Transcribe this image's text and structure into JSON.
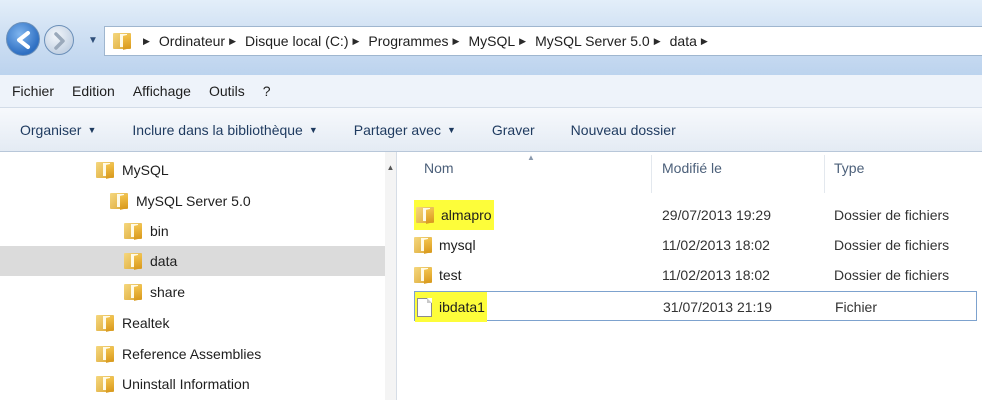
{
  "address": {
    "crumbs": [
      "Ordinateur",
      "Disque local (C:)",
      "Programmes",
      "MySQL",
      "MySQL Server 5.0",
      "data"
    ]
  },
  "menu": [
    "Fichier",
    "Edition",
    "Affichage",
    "Outils",
    "?"
  ],
  "commands": [
    {
      "label": "Organiser",
      "dropdown": true
    },
    {
      "label": "Inclure dans la bibliothèque",
      "dropdown": true
    },
    {
      "label": "Partager avec",
      "dropdown": true
    },
    {
      "label": "Graver",
      "dropdown": false
    },
    {
      "label": "Nouveau dossier",
      "dropdown": false
    }
  ],
  "tree": [
    {
      "label": "MySQL",
      "icon": "folder-icon",
      "selected": false
    },
    {
      "label": "MySQL Server 5.0",
      "icon": "folder-icon",
      "selected": false
    },
    {
      "label": "bin",
      "icon": "folder-icon",
      "selected": false
    },
    {
      "label": "data",
      "icon": "folder-icon",
      "selected": true
    },
    {
      "label": "share",
      "icon": "folder-icon",
      "selected": false
    },
    {
      "label": "Realtek",
      "icon": "folder-icon",
      "selected": false
    },
    {
      "label": "Reference Assemblies",
      "icon": "folder-icon",
      "selected": false
    },
    {
      "label": "Uninstall Information",
      "icon": "folder-icon",
      "selected": false
    }
  ],
  "columns": {
    "name": "Nom",
    "modified": "Modifié le",
    "type": "Type"
  },
  "files": [
    {
      "name": "almapro",
      "modified": "29/07/2013 19:29",
      "type": "Dossier de fichiers",
      "icon": "folder-icon",
      "highlighted": true
    },
    {
      "name": "mysql",
      "modified": "11/02/2013 18:02",
      "type": "Dossier de fichiers",
      "icon": "folder-icon",
      "highlighted": false
    },
    {
      "name": "test",
      "modified": "11/02/2013 18:02",
      "type": "Dossier de fichiers",
      "icon": "folder-icon",
      "highlighted": false
    },
    {
      "name": "ibdata1",
      "modified": "31/07/2013 21:19",
      "type": "Fichier",
      "icon": "file-icon",
      "highlighted": true
    }
  ],
  "colors": {
    "highlight": "#fdfd3a",
    "selection": "#dbdbdb",
    "accent": "#2e6fc2"
  }
}
